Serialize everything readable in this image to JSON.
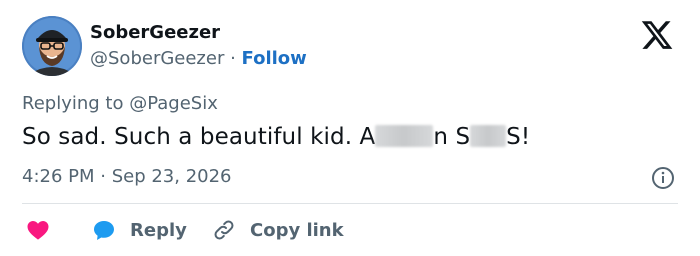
{
  "user": {
    "display_name": "SoberGeezer",
    "handle": "@SoberGeezer",
    "separator": " · ",
    "follow_label": "Follow",
    "avatar_icon": "avatar-cartoon-bearded-man-icon"
  },
  "brand": {
    "logo_icon": "x-logo-icon"
  },
  "reply": {
    "prefix": "Replying to ",
    "mention": "@PageSix"
  },
  "tweet": {
    "text_part1": "So sad. Such a beautiful kid. A",
    "text_part2": "n S",
    "text_part3": "S!"
  },
  "meta": {
    "timestamp": "4:26 PM · Sep 23, 2026",
    "info_icon": "info-icon"
  },
  "actions": {
    "like_icon": "heart-icon",
    "reply_icon": "speech-bubble-icon",
    "reply_label": "Reply",
    "copy_icon": "link-icon",
    "copy_label": "Copy link"
  },
  "colors": {
    "text": "#0f1419",
    "muted": "#536471",
    "link": "#1d70c4",
    "heart": "#f91880",
    "reply_bubble": "#1d9bf0"
  }
}
